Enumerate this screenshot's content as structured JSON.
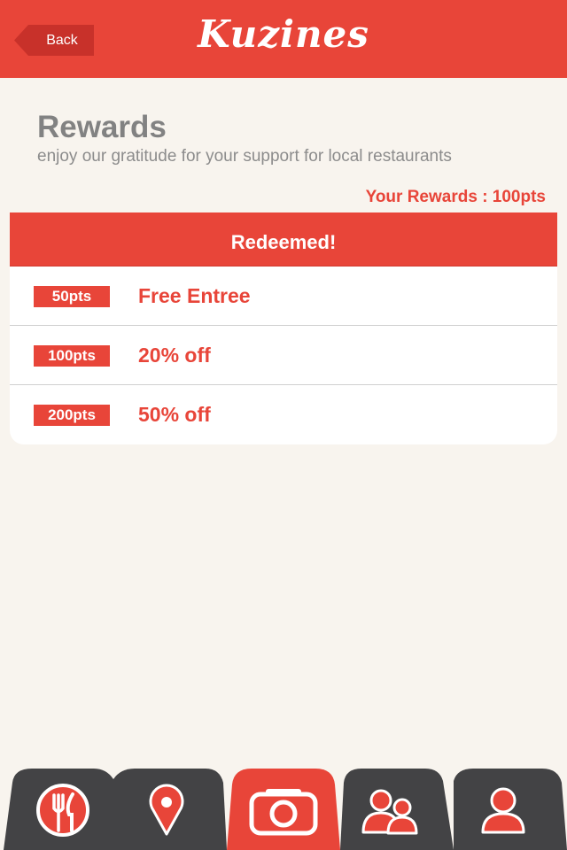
{
  "header": {
    "back_label": "Back",
    "logo_text": "Kuzines"
  },
  "page": {
    "title": "Rewards",
    "subtitle": "enjoy our gratitude for your support for local restaurants",
    "points_summary": "Your Rewards : 100pts"
  },
  "rewards": {
    "header_label": "Redeemed!",
    "items": [
      {
        "points": "50pts",
        "label": "Free Entree"
      },
      {
        "points": "100pts",
        "label": "20% off"
      },
      {
        "points": "200pts",
        "label": "50% off"
      }
    ]
  },
  "tabbar": {
    "tabs": [
      {
        "icon": "fork-knife-icon",
        "active": false
      },
      {
        "icon": "map-pin-icon",
        "active": false
      },
      {
        "icon": "camera-icon",
        "active": true
      },
      {
        "icon": "friends-icon",
        "active": false
      },
      {
        "icon": "profile-icon",
        "active": false
      }
    ]
  },
  "colors": {
    "accent": "#e84539",
    "background": "#f8f4ee",
    "tab_inactive": "#434345",
    "title_gray": "#828282"
  }
}
